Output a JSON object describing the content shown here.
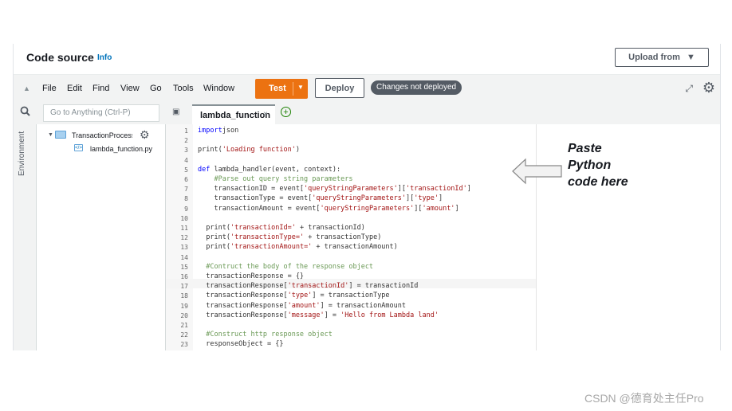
{
  "header": {
    "title": "Code source",
    "info_link": "Info",
    "upload_button": "Upload from"
  },
  "menubar": {
    "items": [
      "File",
      "Edit",
      "Find",
      "View",
      "Go",
      "Tools",
      "Window"
    ],
    "test_button": "Test",
    "deploy_button": "Deploy",
    "status_badge": "Changes not deployed"
  },
  "search": {
    "placeholder": "Go to Anything (Ctrl-P)"
  },
  "editor_tab": {
    "label": "lambda_function"
  },
  "sidebar": {
    "environment_label": "Environment"
  },
  "file_tree": {
    "folder": "TransactionProcessor",
    "file": "lambda_function.py"
  },
  "code_lines": [
    {
      "n": "1",
      "parts": [
        [
          "kw",
          "import"
        ],
        [
          "",
          "json"
        ]
      ]
    },
    {
      "n": "2",
      "parts": []
    },
    {
      "n": "3",
      "parts": [
        [
          "",
          "print("
        ],
        [
          "str",
          "'Loading function'"
        ],
        [
          "",
          ")"
        ]
      ]
    },
    {
      "n": "4",
      "parts": []
    },
    {
      "n": "5",
      "parts": [
        [
          "kw",
          "def"
        ],
        [
          "",
          " lambda_handler(event, context):"
        ]
      ]
    },
    {
      "n": "6",
      "parts": [
        [
          "cm",
          "    #Parse out query string parameters"
        ]
      ]
    },
    {
      "n": "7",
      "parts": [
        [
          "",
          "    transactionID = event["
        ],
        [
          "str",
          "'queryStringParameters'"
        ],
        [
          "",
          "]["
        ],
        [
          "str",
          "'transactionId'"
        ],
        [
          "",
          "]"
        ]
      ]
    },
    {
      "n": "8",
      "parts": [
        [
          "",
          "    transactionType = event["
        ],
        [
          "str",
          "'queryStringParameters'"
        ],
        [
          "",
          "]["
        ],
        [
          "str",
          "'type'"
        ],
        [
          "",
          "]"
        ]
      ]
    },
    {
      "n": "9",
      "parts": [
        [
          "",
          "    transactionAmount = event["
        ],
        [
          "str",
          "'queryStringParameters'"
        ],
        [
          "",
          "]["
        ],
        [
          "str",
          "'amount'"
        ],
        [
          "",
          "]"
        ]
      ]
    },
    {
      "n": "10",
      "parts": []
    },
    {
      "n": "11",
      "parts": [
        [
          "",
          "  print("
        ],
        [
          "str",
          "'transactionId='"
        ],
        [
          "",
          " + transactionId)"
        ]
      ]
    },
    {
      "n": "12",
      "parts": [
        [
          "",
          "  print("
        ],
        [
          "str",
          "'transactionType='"
        ],
        [
          "",
          " + transactionType)"
        ]
      ]
    },
    {
      "n": "13",
      "parts": [
        [
          "",
          "  print("
        ],
        [
          "str",
          "'transactionAmount='"
        ],
        [
          "",
          " + transactionAmount)"
        ]
      ]
    },
    {
      "n": "14",
      "parts": []
    },
    {
      "n": "15",
      "parts": [
        [
          "cm",
          "  #Contruct the body of the response object"
        ]
      ]
    },
    {
      "n": "16",
      "parts": [
        [
          "",
          "  transactionResponse = {}"
        ]
      ]
    },
    {
      "n": "17",
      "parts": [
        [
          "",
          "  transactionResponse["
        ],
        [
          "str",
          "'transactionId'"
        ],
        [
          "",
          "] = transactionId"
        ]
      ]
    },
    {
      "n": "18",
      "parts": [
        [
          "",
          "  transactionResponse["
        ],
        [
          "str",
          "'type'"
        ],
        [
          "",
          "] = transactionType"
        ]
      ]
    },
    {
      "n": "19",
      "parts": [
        [
          "",
          "  transactionResponse["
        ],
        [
          "str",
          "'amount'"
        ],
        [
          "",
          "] = transactionAmount"
        ]
      ]
    },
    {
      "n": "20",
      "parts": [
        [
          "",
          "  transactionResponse["
        ],
        [
          "str",
          "'message'"
        ],
        [
          "",
          "] = "
        ],
        [
          "str",
          "'Hello from Lambda land'"
        ]
      ]
    },
    {
      "n": "21",
      "parts": []
    },
    {
      "n": "22",
      "parts": [
        [
          "cm",
          "  #Construct http response object"
        ]
      ]
    },
    {
      "n": "23",
      "parts": [
        [
          "",
          "  responseObject = {}"
        ]
      ]
    }
  ],
  "annotation": {
    "line1": "Paste",
    "line2": "Python",
    "line3": "code here"
  },
  "watermark": "CSDN @德育处主任Pro",
  "colors": {
    "accent": "#ec7211",
    "badge": "#545b64",
    "link": "#0073bb"
  }
}
